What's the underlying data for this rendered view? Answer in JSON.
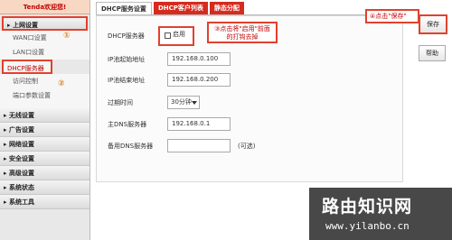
{
  "sidebar": {
    "brand": "Tenda欢迎您!",
    "net_section": "上网设置",
    "net_subitems": [
      "WAN口设置",
      "LAN口设置",
      "DHCP服务器",
      "访问控制",
      "端口参数设置"
    ],
    "sections": [
      "无线设置",
      "广告设置",
      "网络设置",
      "安全设置",
      "高级设置",
      "系统状态",
      "系统工具"
    ],
    "step1_num": "①",
    "step2_num": "②"
  },
  "tabs": [
    "DHCP服务设置",
    "DHCP客户列表",
    "静态分配"
  ],
  "form": {
    "dhcp_label": "DHCP服务器",
    "enable_label": "启用",
    "start_ip_label": "IP池起始地址",
    "start_ip_value": "192.168.0.100",
    "end_ip_label": "IP池结束地址",
    "end_ip_value": "192.168.0.200",
    "lease_label": "过期时间",
    "lease_value": "30分钟",
    "primary_dns_label": "主DNS服务器",
    "primary_dns_value": "192.168.0.1",
    "backup_dns_label": "备用DNS服务器",
    "backup_dns_value": "",
    "optional_hint": "(可选)"
  },
  "callouts": {
    "step3": "③点击将\"启用\"前面的打钩去掉",
    "step4": "④点击\"保存\""
  },
  "buttons": {
    "save": "保存",
    "help": "帮助"
  },
  "watermark": {
    "title": "路由知识网",
    "url": "www.yilanbo.cn"
  }
}
